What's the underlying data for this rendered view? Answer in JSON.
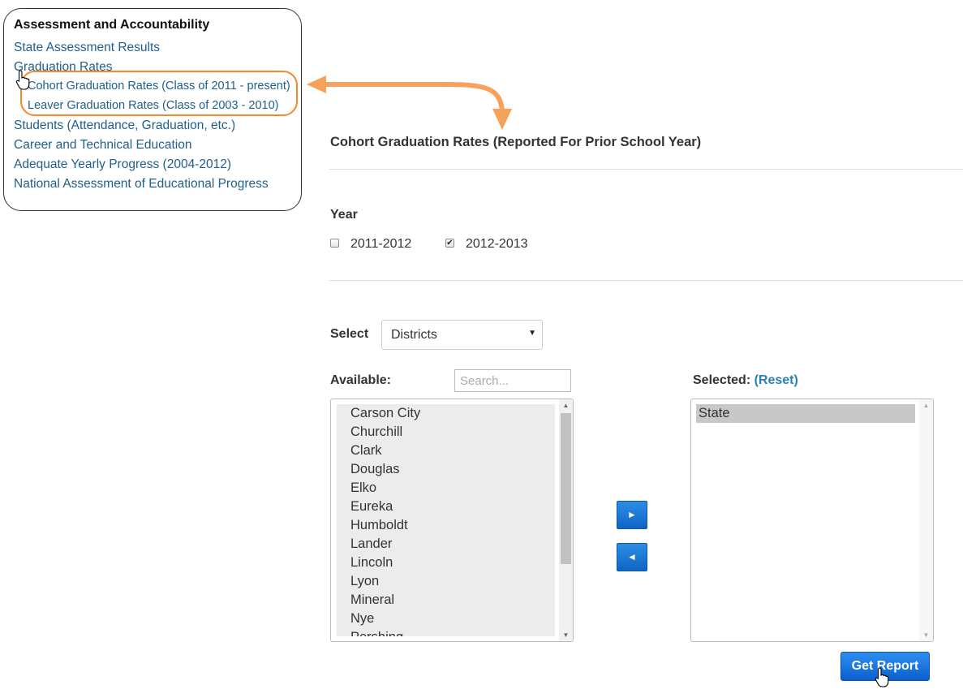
{
  "nav": {
    "heading": "Assessment and Accountability",
    "items": [
      {
        "label": "State Assessment Results"
      },
      {
        "label": "Graduation Rates"
      },
      {
        "label": "Cohort Graduation Rates (Class of 2011 - present)"
      },
      {
        "label": "Leaver Graduation Rates (Class of 2003 - 2010)"
      },
      {
        "label": "Students (Attendance, Graduation, etc.)"
      },
      {
        "label": "Career and Technical Education"
      },
      {
        "label": "Adequate Yearly Progress (2004-2012)"
      },
      {
        "label": "National Assessment of Educational Progress"
      }
    ]
  },
  "report": {
    "title": "Cohort Graduation Rates (Reported For Prior School Year)",
    "year_label": "Year",
    "years": [
      {
        "label": "2011-2012",
        "checked": false
      },
      {
        "label": "2012-2013",
        "checked": true
      }
    ],
    "select_label": "Select",
    "select_value": "Districts",
    "available_label": "Available:",
    "search_placeholder": "Search...",
    "selected_label": "Selected:",
    "reset_label": "(Reset)",
    "available_items": [
      "Carson City",
      "Churchill",
      "Clark",
      "Douglas",
      "Elko",
      "Eureka",
      "Humboldt",
      "Lander",
      "Lincoln",
      "Lyon",
      "Mineral",
      "Nye",
      "Pershing"
    ],
    "selected_items": [
      "State"
    ],
    "add_icon": "right-arrow-icon",
    "remove_icon": "left-arrow-icon",
    "get_report_label": "Get Report"
  },
  "colors": {
    "link": "#1f5f8b",
    "highlight": "#f28a2e",
    "button": "#1064c4"
  }
}
